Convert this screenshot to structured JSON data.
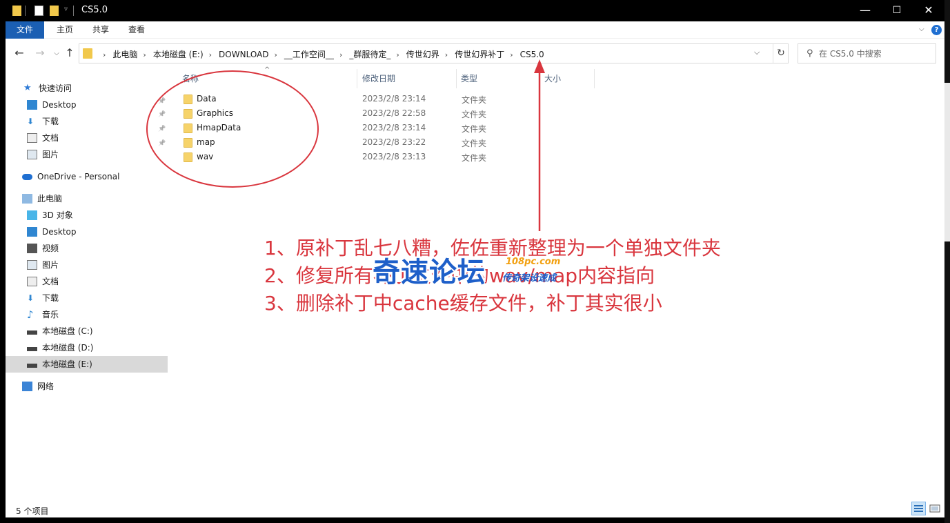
{
  "window": {
    "title": "CS5.0",
    "minimize": "—",
    "maximize": "☐",
    "close": "✕"
  },
  "ribbon": {
    "tabs": [
      "文件",
      "主页",
      "共享",
      "查看"
    ],
    "collapse_glyph": "⌵",
    "help_glyph": "?"
  },
  "nav": {
    "back": "←",
    "forward": "→",
    "recent": "⌵",
    "up": "↑",
    "breadcrumbs": [
      "此电脑",
      "本地磁盘 (E:)",
      "DOWNLOAD",
      "__工作空间__",
      "_群服待定_",
      "传世幻界",
      "传世幻界补丁",
      "CS5.0"
    ],
    "separator": "›",
    "dropdown": "⌵",
    "refresh": "↻",
    "search_placeholder": "在 CS5.0 中搜索"
  },
  "sidebar": {
    "items": [
      {
        "label": "快速访问",
        "icon": "star-icon"
      },
      {
        "label": "Desktop",
        "icon": "desktop-icon"
      },
      {
        "label": "下载",
        "icon": "download-icon"
      },
      {
        "label": "文档",
        "icon": "document-icon"
      },
      {
        "label": "图片",
        "icon": "picture-icon"
      },
      {
        "label": "OneDrive - Personal",
        "icon": "cloud-icon"
      },
      {
        "label": "此电脑",
        "icon": "computer-icon"
      },
      {
        "label": "3D 对象",
        "icon": "cube-icon"
      },
      {
        "label": "Desktop",
        "icon": "desktop-icon"
      },
      {
        "label": "视频",
        "icon": "video-icon"
      },
      {
        "label": "图片",
        "icon": "picture-icon"
      },
      {
        "label": "文档",
        "icon": "document-icon"
      },
      {
        "label": "下载",
        "icon": "download-icon"
      },
      {
        "label": "音乐",
        "icon": "music-icon"
      },
      {
        "label": "本地磁盘 (C:)",
        "icon": "drive-icon"
      },
      {
        "label": "本地磁盘 (D:)",
        "icon": "drive-icon"
      },
      {
        "label": "本地磁盘 (E:)",
        "icon": "drive-icon"
      },
      {
        "label": "网络",
        "icon": "network-icon"
      }
    ],
    "selected": "本地磁盘 (E:)"
  },
  "columns": {
    "name": "名称",
    "date": "修改日期",
    "type": "类型",
    "size": "大小",
    "sort_glyph": "^"
  },
  "files": [
    {
      "name": "Data",
      "date": "2023/2/8 23:14",
      "type": "文件夹"
    },
    {
      "name": "Graphics",
      "date": "2023/2/8 22:58",
      "type": "文件夹"
    },
    {
      "name": "HmapData",
      "date": "2023/2/8 23:14",
      "type": "文件夹"
    },
    {
      "name": "map",
      "date": "2023/2/8 23:22",
      "type": "文件夹"
    },
    {
      "name": "wav",
      "date": "2023/2/8 23:13",
      "type": "文件夹"
    }
  ],
  "annotation": {
    "lines": [
      "1、原补丁乱七八糟，佐佐重新整理为一个单独文件夹",
      "2、修复所有补丁文件中的wav/map内容指向",
      "3、删除补丁中cache缓存文件，补丁其实很小"
    ],
    "color": "#d9363e"
  },
  "watermark": {
    "main": "奇速论坛",
    "url": "108pc.com",
    "sub": "传奇架设速成"
  },
  "status": {
    "count": "5 个项目"
  },
  "colors": {
    "accent": "#1b5fb3",
    "folder": "#f6d36a",
    "selection": "#d9d9d9"
  }
}
